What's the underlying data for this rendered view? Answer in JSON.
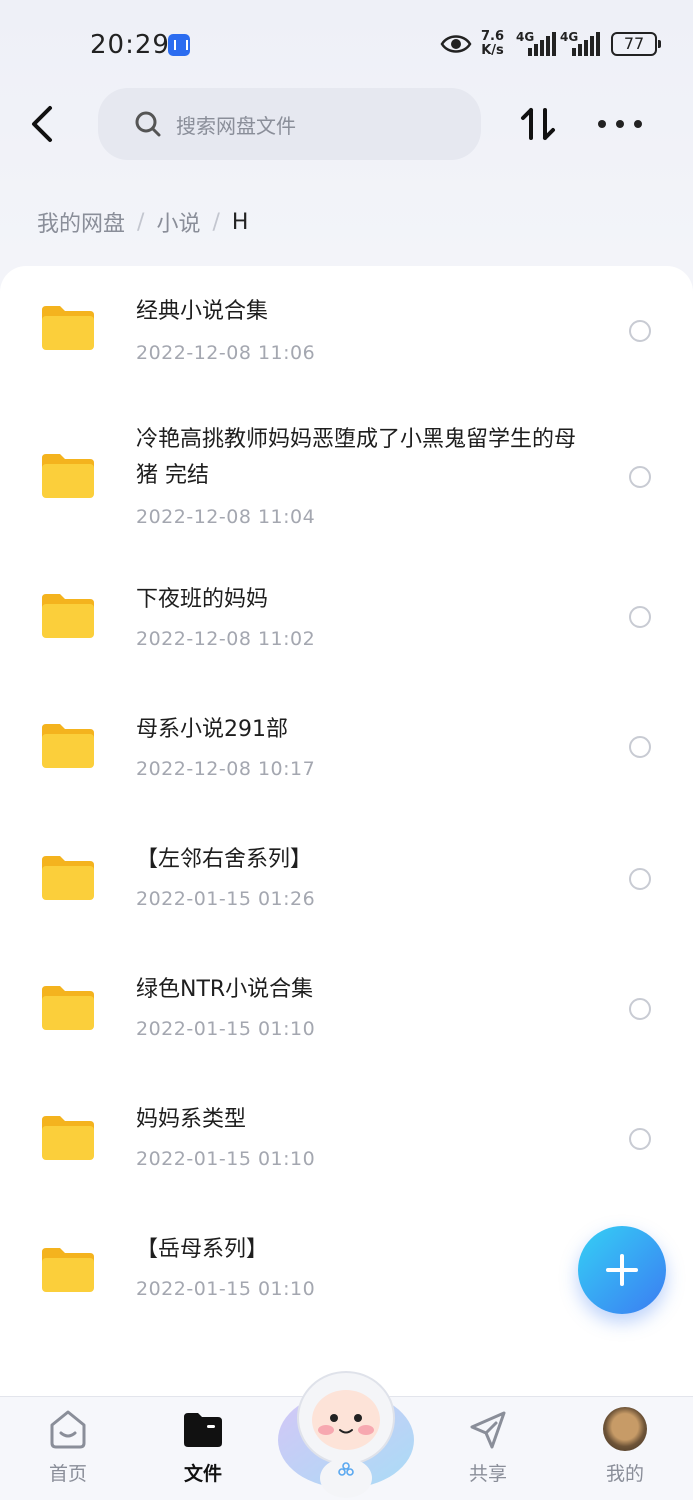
{
  "status_bar": {
    "time": "20:29",
    "speed_value": "7.6",
    "speed_unit": "K/s",
    "signal1": "4G",
    "signal2": "4G",
    "battery": "77"
  },
  "header": {
    "search_placeholder": "搜索网盘文件"
  },
  "breadcrumb": {
    "root": "我的网盘",
    "sep": "/",
    "parent": "小说",
    "current": "H"
  },
  "files": [
    {
      "name": "经典小说合集",
      "date": "2022-12-08  11:06"
    },
    {
      "name": "冷艳高挑教师妈妈恶堕成了小黑鬼留学生的母猪 完结",
      "date": "2022-12-08  11:04"
    },
    {
      "name": "下夜班的妈妈",
      "date": "2022-12-08  11:02"
    },
    {
      "name": "母系小说291部",
      "date": "2022-12-08  10:17"
    },
    {
      "name": "【左邻右舍系列】",
      "date": "2022-01-15  01:26"
    },
    {
      "name": "绿色NTR小说合集",
      "date": "2022-01-15  01:10"
    },
    {
      "name": "妈妈系类型",
      "date": "2022-01-15  01:10"
    },
    {
      "name": "【岳母系列】",
      "date": "2022-01-15  01:10"
    }
  ],
  "bottom_nav": {
    "home": "首页",
    "files": "文件",
    "share": "共享",
    "mine": "我的"
  },
  "colors": {
    "folder": "#fbcf3b",
    "accent": "#3b7cf2"
  }
}
